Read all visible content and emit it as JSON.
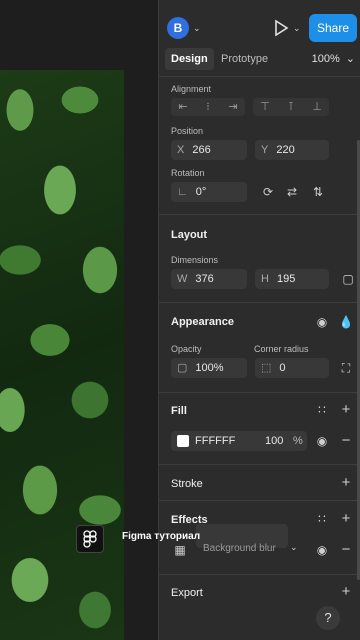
{
  "topbar": {
    "avatar_letter": "B",
    "share_label": "Share"
  },
  "tabs": {
    "design": "Design",
    "prototype": "Prototype",
    "zoom": "100%"
  },
  "alignment": {
    "label": "Alignment"
  },
  "position": {
    "label": "Position",
    "x_prefix": "X",
    "x_value": "266",
    "y_prefix": "Y",
    "y_value": "220"
  },
  "rotation": {
    "label": "Rotation",
    "value": "0°"
  },
  "layout": {
    "title": "Layout",
    "dimensions_label": "Dimensions",
    "w_prefix": "W",
    "w_value": "376",
    "h_prefix": "H",
    "h_value": "195"
  },
  "appearance": {
    "title": "Appearance",
    "opacity_label": "Opacity",
    "opacity_value": "100%",
    "radius_label": "Corner radius",
    "radius_value": "0"
  },
  "fill": {
    "title": "Fill",
    "hex": "FFFFFF",
    "opacity": "100",
    "pct": "%",
    "color": "#ffffff"
  },
  "stroke": {
    "title": "Stroke"
  },
  "effects": {
    "title": "Effects",
    "effect_name": "Background blur"
  },
  "export": {
    "title": "Export"
  },
  "overlay": {
    "caption": "Figma туториал"
  },
  "help": {
    "label": "?"
  }
}
